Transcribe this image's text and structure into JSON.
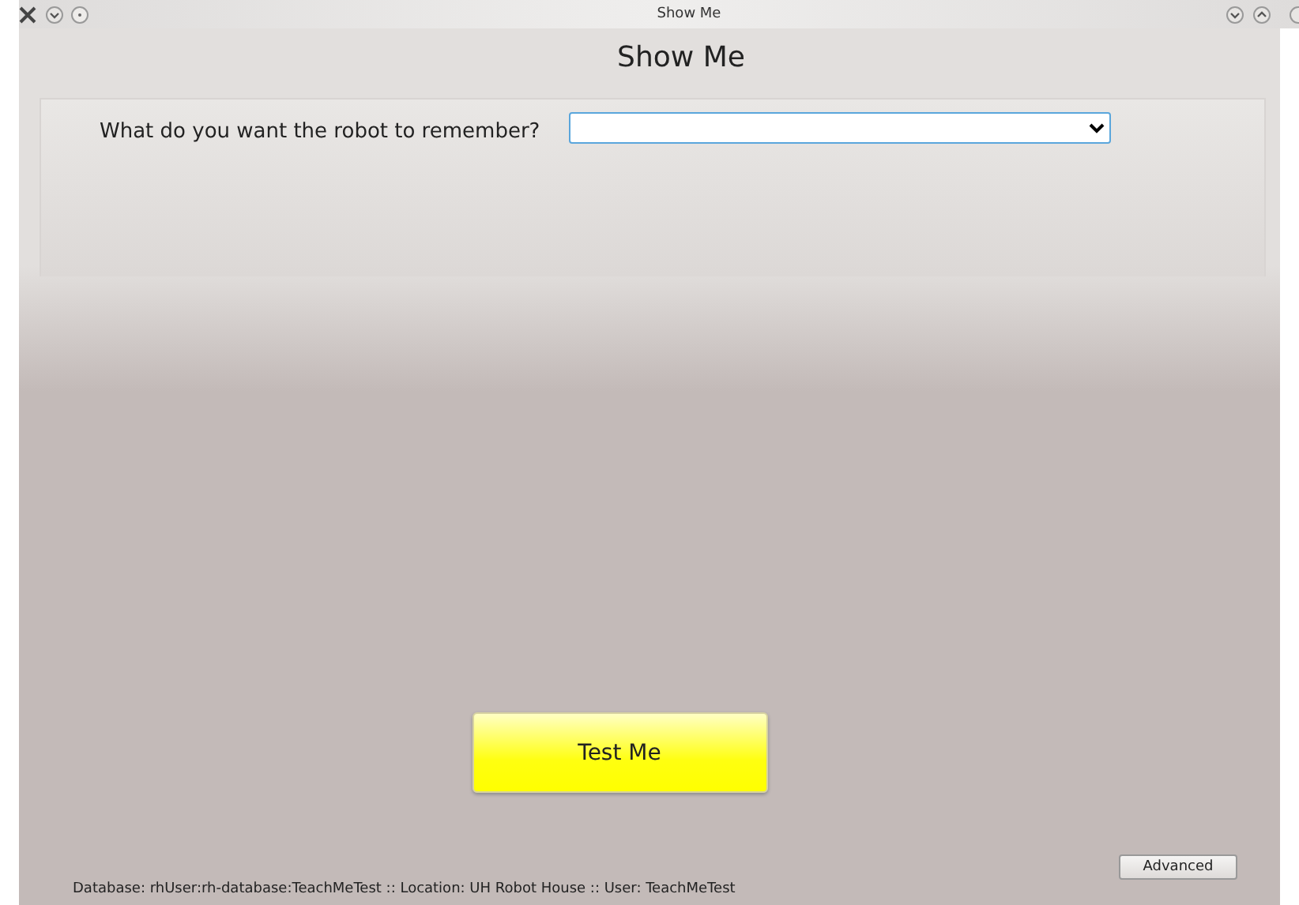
{
  "window": {
    "title": "Show Me"
  },
  "heading": "Show Me",
  "question": {
    "label": "What do you want the robot to remember?"
  },
  "test_button": "Test Me",
  "advanced_button": "Advanced",
  "status_bar": "Database: rhUser:rh-database:TeachMeTest :: Location: UH Robot House :: User: TeachMeTest"
}
